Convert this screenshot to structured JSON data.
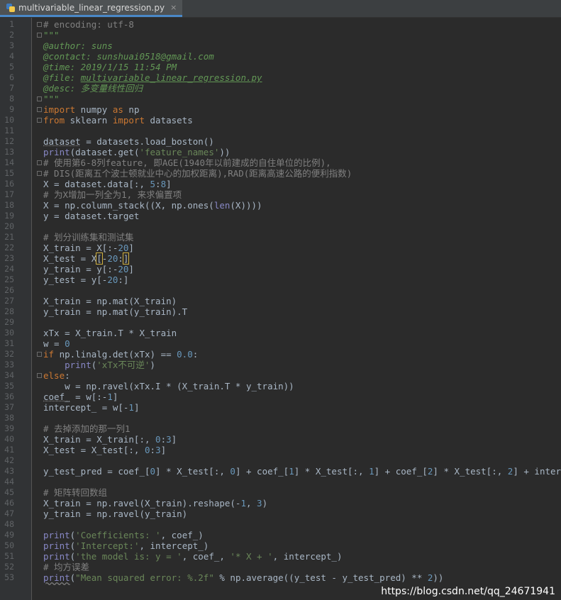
{
  "tab": {
    "file_name": "multivariable_linear_regression.py",
    "close": "×",
    "icon": "python-file-icon"
  },
  "lines": [
    {
      "n": "1",
      "fold": true,
      "t": [
        [
          "c",
          "# encoding: utf-8"
        ]
      ]
    },
    {
      "n": "2",
      "fold": true,
      "t": [
        [
          "d",
          "\"\"\""
        ]
      ]
    },
    {
      "n": "3",
      "t": [
        [
          "d",
          "@author: suns"
        ]
      ]
    },
    {
      "n": "4",
      "t": [
        [
          "d",
          "@contact: sunshuai0518@gmail.com"
        ]
      ]
    },
    {
      "n": "5",
      "t": [
        [
          "d",
          "@time: 2019/1/15 11:54 PM"
        ]
      ]
    },
    {
      "n": "6",
      "t": [
        [
          "d",
          "@file: "
        ],
        [
          "du",
          "multivariable_linear_regression.py"
        ]
      ]
    },
    {
      "n": "7",
      "t": [
        [
          "d",
          "@desc: 多变量线性回归"
        ]
      ]
    },
    {
      "n": "8",
      "fold": true,
      "t": [
        [
          "d",
          "\"\"\""
        ]
      ]
    },
    {
      "n": "9",
      "fold": true,
      "t": [
        [
          "k",
          "import"
        ],
        [
          "p",
          " numpy "
        ],
        [
          "k",
          "as"
        ],
        [
          "p",
          " np"
        ]
      ]
    },
    {
      "n": "10",
      "fold": true,
      "t": [
        [
          "k",
          "from"
        ],
        [
          "p",
          " sklearn "
        ],
        [
          "k",
          "import"
        ],
        [
          "p",
          " datasets"
        ]
      ]
    },
    {
      "n": "11",
      "t": []
    },
    {
      "n": "12",
      "t": [
        [
          "w",
          "dataset"
        ],
        [
          "p",
          " = datasets.load_boston()"
        ]
      ]
    },
    {
      "n": "13",
      "t": [
        [
          "b",
          "print"
        ],
        [
          "p",
          "(dataset.get("
        ],
        [
          "s",
          "'feature_names'"
        ],
        [
          "p",
          "))"
        ]
      ]
    },
    {
      "n": "14",
      "fold": true,
      "t": [
        [
          "c",
          "# 使用第6-8列feature, 即AGE(1940年以前建成的自住单位的比例),"
        ]
      ]
    },
    {
      "n": "15",
      "fold": true,
      "t": [
        [
          "c",
          "# DIS(距离五个波士顿就业中心的加权距离),RAD(距离高速公路的便利指数)"
        ]
      ]
    },
    {
      "n": "16",
      "t": [
        [
          "p",
          "X = dataset.data[:, "
        ],
        [
          "n",
          "5"
        ],
        [
          "p",
          ":"
        ],
        [
          "n",
          "8"
        ],
        [
          "p",
          "]"
        ]
      ]
    },
    {
      "n": "17",
      "t": [
        [
          "c",
          "# 为X增加一列全为1, 来求偏置项"
        ]
      ]
    },
    {
      "n": "18",
      "t": [
        [
          "p",
          "X = np.column_stack((X, np.ones("
        ],
        [
          "b",
          "len"
        ],
        [
          "p",
          "(X))))"
        ]
      ]
    },
    {
      "n": "19",
      "t": [
        [
          "p",
          "y = dataset.target"
        ]
      ]
    },
    {
      "n": "20",
      "t": []
    },
    {
      "n": "21",
      "t": [
        [
          "c",
          "# 划分训练集和测试集"
        ]
      ]
    },
    {
      "n": "22",
      "t": [
        [
          "p",
          "X_train = X[:-"
        ],
        [
          "n",
          "20"
        ],
        [
          "p",
          "]"
        ]
      ]
    },
    {
      "n": "23",
      "t": [
        [
          "p",
          "X_test = X"
        ],
        [
          "pb",
          "["
        ],
        [
          "p",
          "-"
        ],
        [
          "n",
          "20"
        ],
        [
          "p",
          ":"
        ],
        [
          "pb",
          "]"
        ]
      ]
    },
    {
      "n": "24",
      "t": [
        [
          "p",
          "y_train = y[:-"
        ],
        [
          "n",
          "20"
        ],
        [
          "p",
          "]"
        ]
      ]
    },
    {
      "n": "25",
      "t": [
        [
          "p",
          "y_test = y[-"
        ],
        [
          "n",
          "20"
        ],
        [
          "p",
          ":]"
        ]
      ]
    },
    {
      "n": "26",
      "t": []
    },
    {
      "n": "27",
      "t": [
        [
          "p",
          "X_train = np.mat(X_train)"
        ]
      ]
    },
    {
      "n": "28",
      "t": [
        [
          "p",
          "y_train = np.mat(y_train).T"
        ]
      ]
    },
    {
      "n": "29",
      "t": []
    },
    {
      "n": "30",
      "t": [
        [
          "p",
          "xTx = X_train.T * X_train"
        ]
      ]
    },
    {
      "n": "31",
      "t": [
        [
          "p",
          "w = "
        ],
        [
          "n",
          "0"
        ]
      ]
    },
    {
      "n": "32",
      "fold": true,
      "t": [
        [
          "k",
          "if"
        ],
        [
          "p",
          " np.linalg.det(xTx) == "
        ],
        [
          "n",
          "0.0"
        ],
        [
          "p",
          ":"
        ]
      ]
    },
    {
      "n": "33",
      "t": [
        [
          "p",
          "    "
        ],
        [
          "b",
          "print"
        ],
        [
          "p",
          "("
        ],
        [
          "s",
          "'xTx不可逆'"
        ],
        [
          "p",
          ")"
        ]
      ]
    },
    {
      "n": "34",
      "fold": true,
      "t": [
        [
          "k",
          "else"
        ],
        [
          "p",
          ":"
        ]
      ]
    },
    {
      "n": "35",
      "t": [
        [
          "p",
          "    w = np.ravel(xTx.I * (X_train.T * y_train))"
        ]
      ]
    },
    {
      "n": "36",
      "t": [
        [
          "w",
          "coef_"
        ],
        [
          "p",
          " = w[:-"
        ],
        [
          "n",
          "1"
        ],
        [
          "p",
          "]"
        ]
      ]
    },
    {
      "n": "37",
      "t": [
        [
          "p",
          "intercept_ = w[-"
        ],
        [
          "n",
          "1"
        ],
        [
          "p",
          "]"
        ]
      ]
    },
    {
      "n": "38",
      "t": []
    },
    {
      "n": "39",
      "t": [
        [
          "c",
          "# 去掉添加的那一列1"
        ]
      ]
    },
    {
      "n": "40",
      "t": [
        [
          "p",
          "X_train = X_train[:, "
        ],
        [
          "n",
          "0"
        ],
        [
          "p",
          ":"
        ],
        [
          "n",
          "3"
        ],
        [
          "p",
          "]"
        ]
      ]
    },
    {
      "n": "41",
      "t": [
        [
          "p",
          "X_test = X_test[:, "
        ],
        [
          "n",
          "0"
        ],
        [
          "p",
          ":"
        ],
        [
          "n",
          "3"
        ],
        [
          "p",
          "]"
        ]
      ]
    },
    {
      "n": "42",
      "t": []
    },
    {
      "n": "43",
      "t": [
        [
          "p",
          "y_test_pred = coef_["
        ],
        [
          "n",
          "0"
        ],
        [
          "p",
          "] * X_test[:, "
        ],
        [
          "n",
          "0"
        ],
        [
          "p",
          "] + coef_["
        ],
        [
          "n",
          "1"
        ],
        [
          "p",
          "] * X_test[:, "
        ],
        [
          "n",
          "1"
        ],
        [
          "p",
          "] + coef_["
        ],
        [
          "n",
          "2"
        ],
        [
          "p",
          "] * X_test[:, "
        ],
        [
          "n",
          "2"
        ],
        [
          "p",
          "] + intercept_"
        ]
      ]
    },
    {
      "n": "44",
      "t": []
    },
    {
      "n": "45",
      "t": [
        [
          "c",
          "# 矩阵转回数组"
        ]
      ]
    },
    {
      "n": "46",
      "t": [
        [
          "p",
          "X_train = np.ravel(X_train).reshape(-"
        ],
        [
          "n",
          "1"
        ],
        [
          "p",
          ", "
        ],
        [
          "n",
          "3"
        ],
        [
          "p",
          ")"
        ]
      ]
    },
    {
      "n": "47",
      "t": [
        [
          "p",
          "y_train = np.ravel(y_train)"
        ]
      ]
    },
    {
      "n": "48",
      "t": []
    },
    {
      "n": "49",
      "t": [
        [
          "b",
          "print"
        ],
        [
          "p",
          "("
        ],
        [
          "s",
          "'Coefficients: '"
        ],
        [
          "p",
          ", coef_)"
        ]
      ]
    },
    {
      "n": "50",
      "t": [
        [
          "b",
          "print"
        ],
        [
          "p",
          "("
        ],
        [
          "s",
          "'Intercept:'"
        ],
        [
          "p",
          ", intercept_)"
        ]
      ]
    },
    {
      "n": "51",
      "t": [
        [
          "b",
          "print"
        ],
        [
          "p",
          "("
        ],
        [
          "s",
          "'the model is: y = '"
        ],
        [
          "p",
          ", coef_, "
        ],
        [
          "s",
          "'* X + '"
        ],
        [
          "p",
          ", intercept_)"
        ]
      ]
    },
    {
      "n": "52",
      "t": [
        [
          "c",
          "# 均方误差"
        ]
      ]
    },
    {
      "n": "53",
      "t": [
        [
          "bw",
          "print"
        ],
        [
          "p",
          "("
        ],
        [
          "s",
          "\"Mean squared error: %.2f\""
        ],
        [
          "p",
          " % np.average((y_test - y_test_pred) ** "
        ],
        [
          "n",
          "2"
        ],
        [
          "p",
          "))"
        ]
      ]
    }
  ],
  "watermark": "https://blog.csdn.net/qq_24671941",
  "colors": {
    "background": "#2b2b2b",
    "comment": "#808080",
    "docstring": "#629755",
    "keyword": "#cc7832",
    "builtin": "#8888c6",
    "string": "#6a8759",
    "number": "#6897bb",
    "plain": "#a9b7c6"
  }
}
